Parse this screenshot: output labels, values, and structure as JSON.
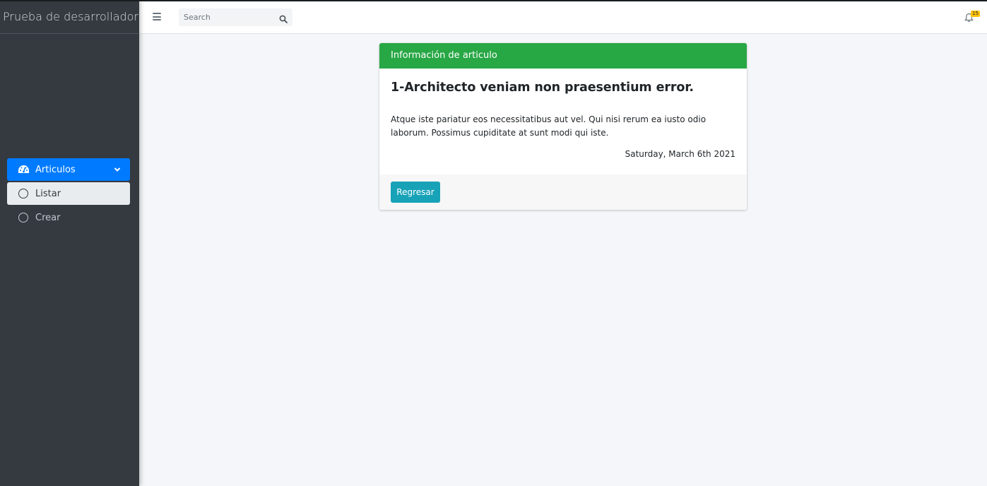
{
  "sidebar": {
    "brand": "Prueba de desarrollador",
    "menu": {
      "label": "Articulos",
      "icon": "tachometer-icon",
      "items": [
        {
          "label": "Listar",
          "active": true
        },
        {
          "label": "Crear",
          "active": false
        }
      ]
    }
  },
  "header": {
    "search_placeholder": "Search",
    "notification_count": "15"
  },
  "card": {
    "header": "Información de articulo",
    "title": "1-Architecto veniam non praesentium error.",
    "text": "Atque iste pariatur eos necessitatibus aut vel. Qui nisi rerum ea iusto odio laborum. Possimus cupiditate at sunt modi qui iste.",
    "date": "Saturday, March 6th 2021",
    "back_label": "Regresar"
  },
  "colors": {
    "sidebar_bg": "#343a40",
    "primary": "#007bff",
    "success": "#28a745",
    "info": "#17a2b8",
    "warning": "#ffc107",
    "content_bg": "#f4f6f9"
  }
}
